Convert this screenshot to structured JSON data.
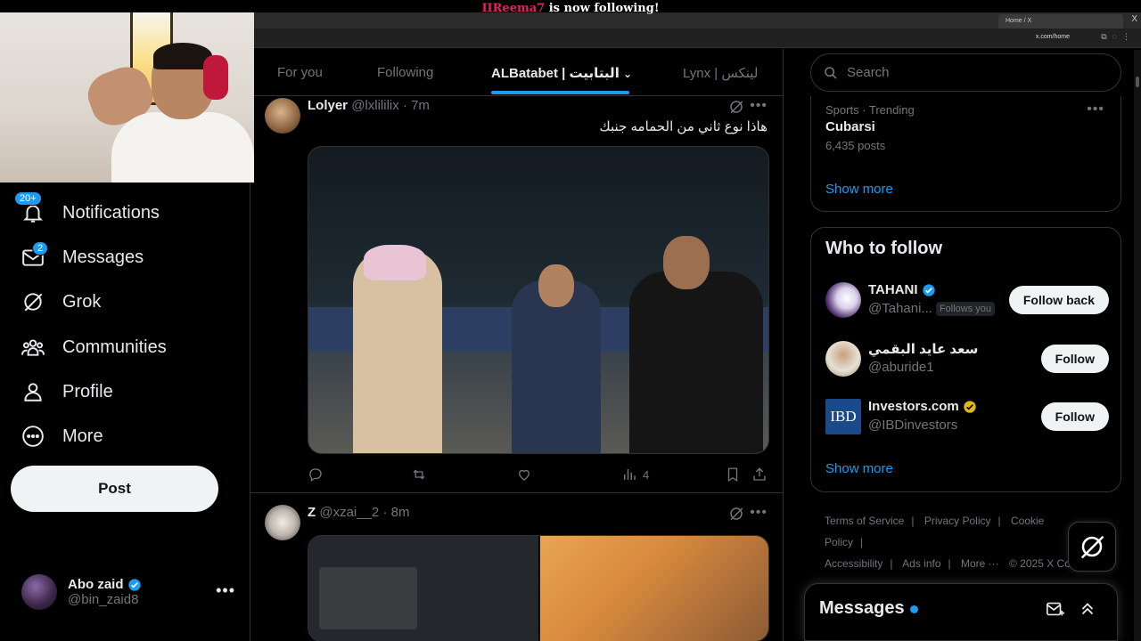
{
  "stream": {
    "follower_name": "IIReema7",
    "follow_message": " is now following!"
  },
  "browser": {
    "tab_title": "Home / X",
    "url": "x.com/home",
    "new_tab": "+",
    "close": "X"
  },
  "sidebar": {
    "items": [
      {
        "label": "Notifications",
        "icon": "bell-icon",
        "badge": "20+"
      },
      {
        "label": "Messages",
        "icon": "envelope-icon",
        "badge": "2"
      },
      {
        "label": "Grok",
        "icon": "grok-icon"
      },
      {
        "label": "Communities",
        "icon": "communities-icon"
      },
      {
        "label": "Profile",
        "icon": "person-icon"
      },
      {
        "label": "More",
        "icon": "more-circle-icon"
      }
    ],
    "post_label": "Post",
    "account": {
      "name": "Abo zaid",
      "handle": "@bin_zaid8"
    }
  },
  "main": {
    "tabs": [
      "For you",
      "Following",
      "ALBatabet | البتابيت",
      "Lynx | لينكس"
    ],
    "active_tab": "ALBatabet | البتابيت",
    "tweets": [
      {
        "name": "Lolyer",
        "handle": "@lxlililix",
        "time": "· 7m",
        "text": "هاذا نوع ثاني من الحمامه جنبك",
        "views": "4"
      },
      {
        "name": "Z",
        "handle": "@xzai__2",
        "time": "· 8m"
      }
    ]
  },
  "right": {
    "search_placeholder": "Search",
    "trend": {
      "category": "Sports · Trending",
      "name": "Cubarsi",
      "count": "6,435 posts"
    },
    "show_more": "Show more",
    "who_to_follow": {
      "title": "Who to follow",
      "users": [
        {
          "name": "TAHANI",
          "handle": "@Tahani...",
          "follows_you": "Follows you",
          "button": "Follow back",
          "verified": "blue"
        },
        {
          "name": "سعد عايد البقمي",
          "handle": "@aburide1",
          "button": "Follow"
        },
        {
          "name": "Investors.com",
          "handle": "@IBDinvestors",
          "button": "Follow",
          "verified": "gold",
          "logo_text": "IBD"
        }
      ]
    },
    "footer": [
      "Terms of Service",
      "|",
      "Privacy Policy",
      "|",
      "Cookie Policy",
      "|",
      "Accessibility",
      "|",
      "Ads info",
      "|",
      "More ···",
      "© 2025 X Corp."
    ],
    "messages_title": "Messages"
  },
  "colors": {
    "accent": "#1d9bf0",
    "gold": "#e2b719",
    "background": "#000000"
  }
}
